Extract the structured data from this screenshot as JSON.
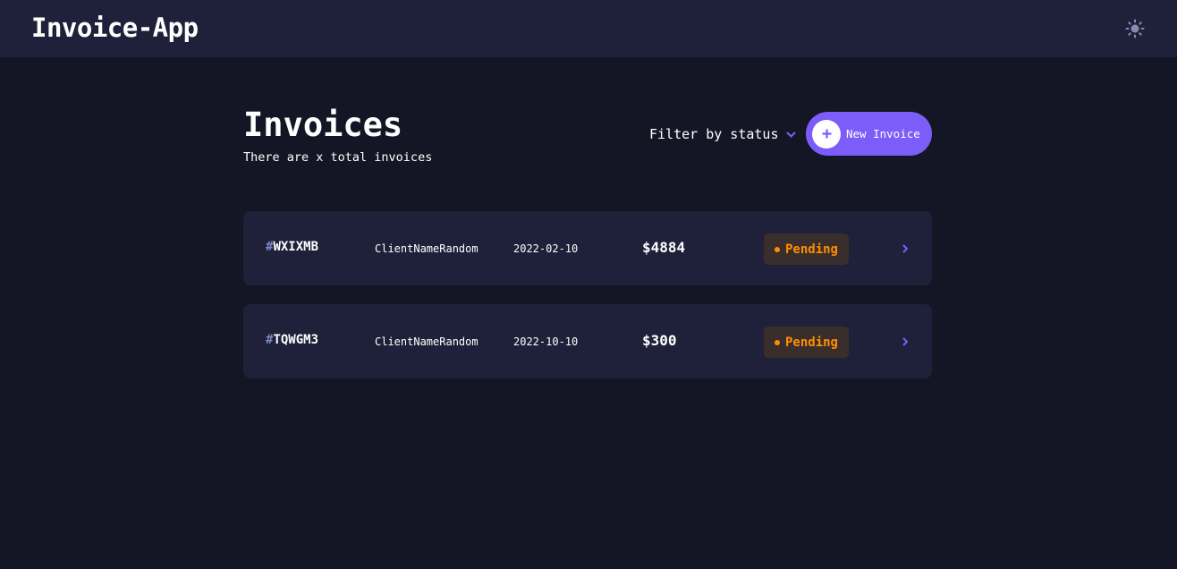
{
  "header": {
    "app_title": "Invoice-App",
    "theme_icon": "sun-icon"
  },
  "main": {
    "title": "Invoices",
    "subtitle": "There are x total invoices",
    "filter_label": "Filter by status",
    "new_invoice_label": "New Invoice"
  },
  "invoices": [
    {
      "hash": "#",
      "id": "WXIXMB",
      "client": "ClientNameRandom",
      "date": "2022-02-10",
      "amount": "$4884",
      "status": "Pending"
    },
    {
      "hash": "#",
      "id": "TQWGM3",
      "client": "ClientNameRandom",
      "date": "2022-10-10",
      "amount": "$300",
      "status": "Pending"
    }
  ],
  "colors": {
    "background": "#141625",
    "surface": "#1e2139",
    "accent": "#7c5dfa",
    "muted": "#7e88c3",
    "pending": "#ff8f00",
    "pending_bg": "#3a2e2c"
  }
}
